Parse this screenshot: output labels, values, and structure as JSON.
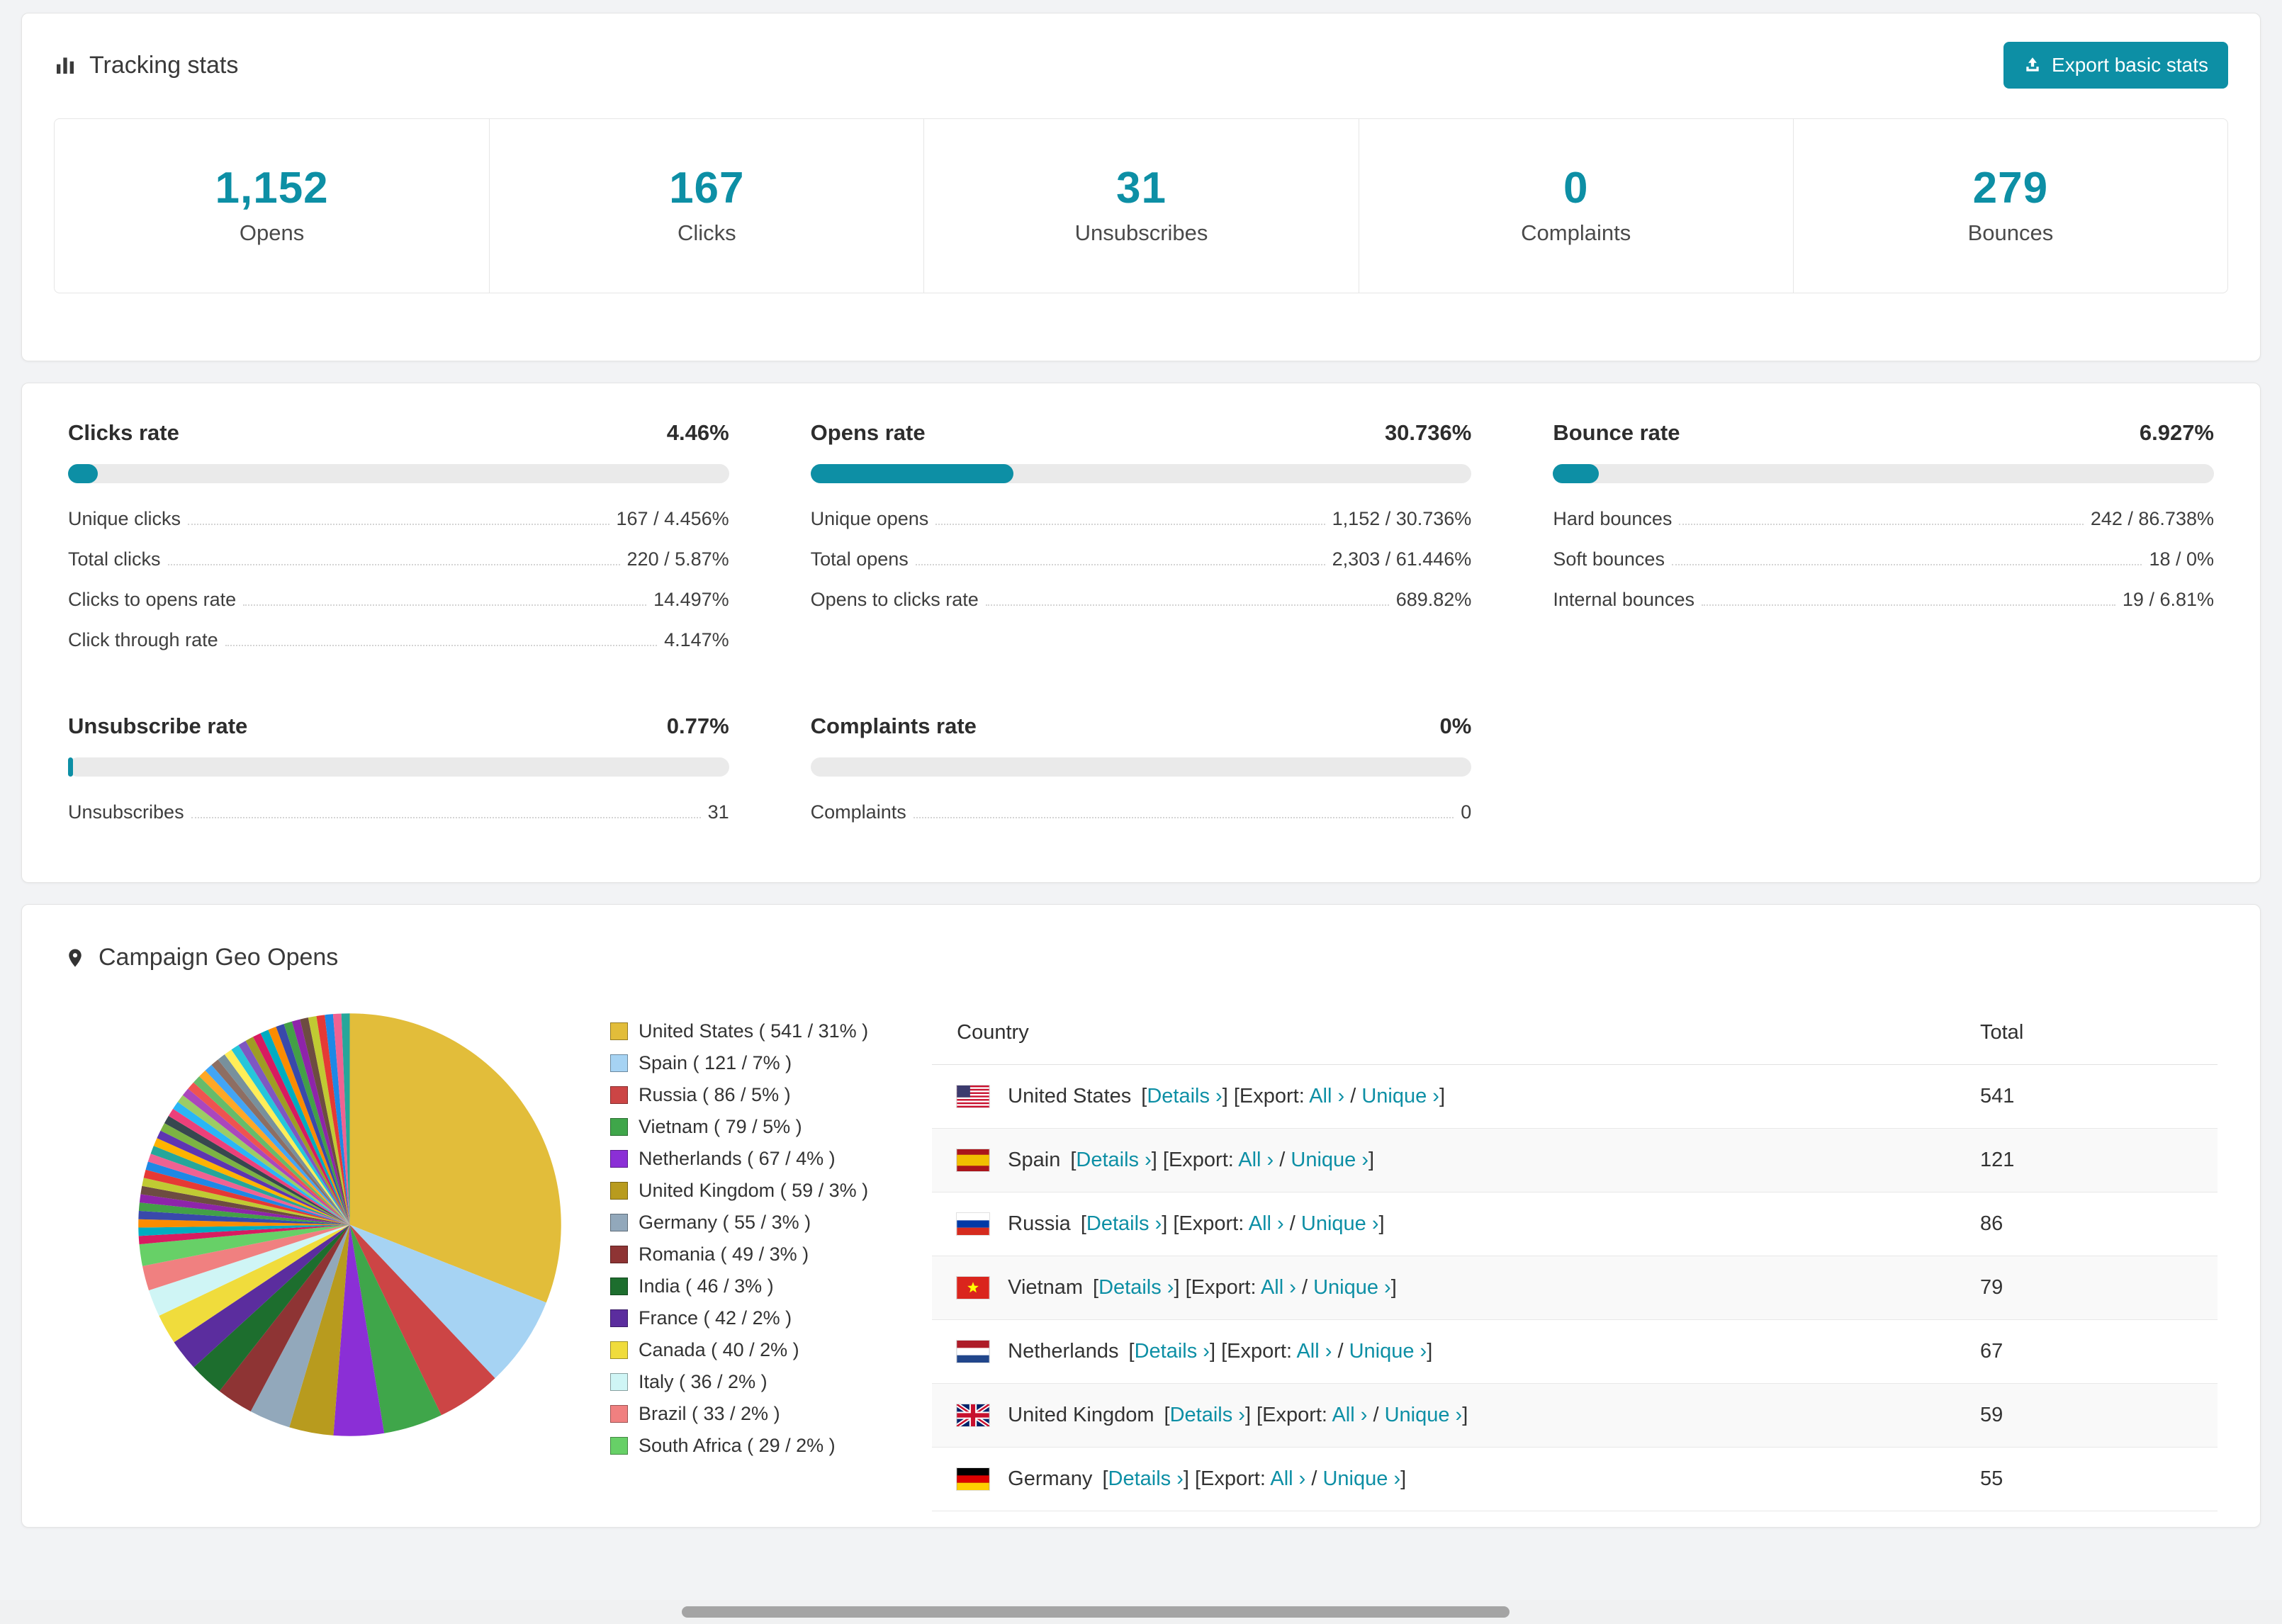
{
  "colors": {
    "accent": "#0d8fa5"
  },
  "header": {
    "title": "Tracking stats",
    "export_button": "Export basic stats"
  },
  "summary": {
    "items": [
      {
        "value": "1,152",
        "label": "Opens"
      },
      {
        "value": "167",
        "label": "Clicks"
      },
      {
        "value": "31",
        "label": "Unsubscribes"
      },
      {
        "value": "0",
        "label": "Complaints"
      },
      {
        "value": "279",
        "label": "Bounces"
      }
    ]
  },
  "rates": {
    "panels": [
      {
        "id": "clicks",
        "title": "Clicks rate",
        "pct_label": "4.46%",
        "pct": 4.46,
        "rows": [
          [
            "Unique clicks",
            "167 / 4.456%"
          ],
          [
            "Total clicks",
            "220 / 5.87%"
          ],
          [
            "Clicks to opens rate",
            "14.497%"
          ],
          [
            "Click through rate",
            "4.147%"
          ]
        ]
      },
      {
        "id": "opens",
        "title": "Opens rate",
        "pct_label": "30.736%",
        "pct": 30.736,
        "rows": [
          [
            "Unique opens",
            "1,152 / 30.736%"
          ],
          [
            "Total opens",
            "2,303 / 61.446%"
          ],
          [
            "Opens to clicks rate",
            "689.82%"
          ]
        ]
      },
      {
        "id": "bounce",
        "title": "Bounce rate",
        "pct_label": "6.927%",
        "pct": 6.927,
        "rows": [
          [
            "Hard bounces",
            "242 / 86.738%"
          ],
          [
            "Soft bounces",
            "18 / 0%"
          ],
          [
            "Internal bounces",
            "19 / 6.81%"
          ]
        ]
      },
      {
        "id": "unsubscribe",
        "title": "Unsubscribe rate",
        "pct_label": "0.77%",
        "pct": 0.77,
        "rows": [
          [
            "Unsubscribes",
            "31"
          ]
        ]
      },
      {
        "id": "complaints",
        "title": "Complaints rate",
        "pct_label": "0%",
        "pct": 0,
        "rows": [
          [
            "Complaints",
            "0"
          ]
        ]
      }
    ]
  },
  "geo": {
    "title": "Campaign Geo Opens",
    "chart_data": {
      "type": "pie",
      "total": 1745,
      "segments": [
        {
          "label": "United States",
          "value": 541,
          "pct": 31,
          "color": "#e2bd3a"
        },
        {
          "label": "Spain",
          "value": 121,
          "pct": 7,
          "color": "#a6d3f3"
        },
        {
          "label": "Russia",
          "value": 86,
          "pct": 5,
          "color": "#cc4545"
        },
        {
          "label": "Vietnam",
          "value": 79,
          "pct": 5,
          "color": "#3fa64a"
        },
        {
          "label": "Netherlands",
          "value": 67,
          "pct": 4,
          "color": "#8b2fd6"
        },
        {
          "label": "United Kingdom",
          "value": 59,
          "pct": 3,
          "color": "#b89b1e"
        },
        {
          "label": "Germany",
          "value": 55,
          "pct": 3,
          "color": "#92a8bb"
        },
        {
          "label": "Romania",
          "value": 49,
          "pct": 3,
          "color": "#8e3434"
        },
        {
          "label": "India",
          "value": 46,
          "pct": 3,
          "color": "#1d6e2e"
        },
        {
          "label": "France",
          "value": 42,
          "pct": 2,
          "color": "#5b2d9e"
        },
        {
          "label": "Canada",
          "value": 40,
          "pct": 2,
          "color": "#f0dc3c"
        },
        {
          "label": "Italy",
          "value": 36,
          "pct": 2,
          "color": "#cff5f5"
        },
        {
          "label": "Brazil",
          "value": 33,
          "pct": 2,
          "color": "#f08080"
        },
        {
          "label": "South Africa",
          "value": 29,
          "pct": 2,
          "color": "#67d067"
        }
      ],
      "others": {
        "value": 462,
        "slices": 42
      },
      "others_palette": [
        "#d81b60",
        "#00acc1",
        "#fb8c00",
        "#3949ab",
        "#43a047",
        "#8e24aa",
        "#6d4c41",
        "#c0ca33",
        "#e53935",
        "#1e88e5",
        "#f06292",
        "#26a69a",
        "#ffb300",
        "#5e35b1",
        "#7cb342",
        "#37474f",
        "#ec407a",
        "#29b6f6",
        "#9ccc65",
        "#ab47bc",
        "#ef5350",
        "#66bb6a",
        "#ffa726",
        "#42a5f5",
        "#8d6e63",
        "#78909c",
        "#ffee58",
        "#26c6da",
        "#7e57c2",
        "#9e9d24"
      ]
    },
    "table": {
      "headers": [
        "Country",
        "Total"
      ],
      "links": {
        "open": "[",
        "close": "]",
        "details": "Details ›",
        "export_prefix": "Export:",
        "all": "All ›",
        "sep": "/",
        "unique": "Unique ›"
      },
      "rows": [
        {
          "country": "United States",
          "flag": "us",
          "total": "541"
        },
        {
          "country": "Spain",
          "flag": "es",
          "total": "121"
        },
        {
          "country": "Russia",
          "flag": "ru",
          "total": "86"
        },
        {
          "country": "Vietnam",
          "flag": "vn",
          "total": "79"
        },
        {
          "country": "Netherlands",
          "flag": "nl",
          "total": "67"
        },
        {
          "country": "United Kingdom",
          "flag": "gb",
          "total": "59"
        },
        {
          "country": "Germany",
          "flag": "de",
          "total": "55"
        }
      ]
    }
  }
}
